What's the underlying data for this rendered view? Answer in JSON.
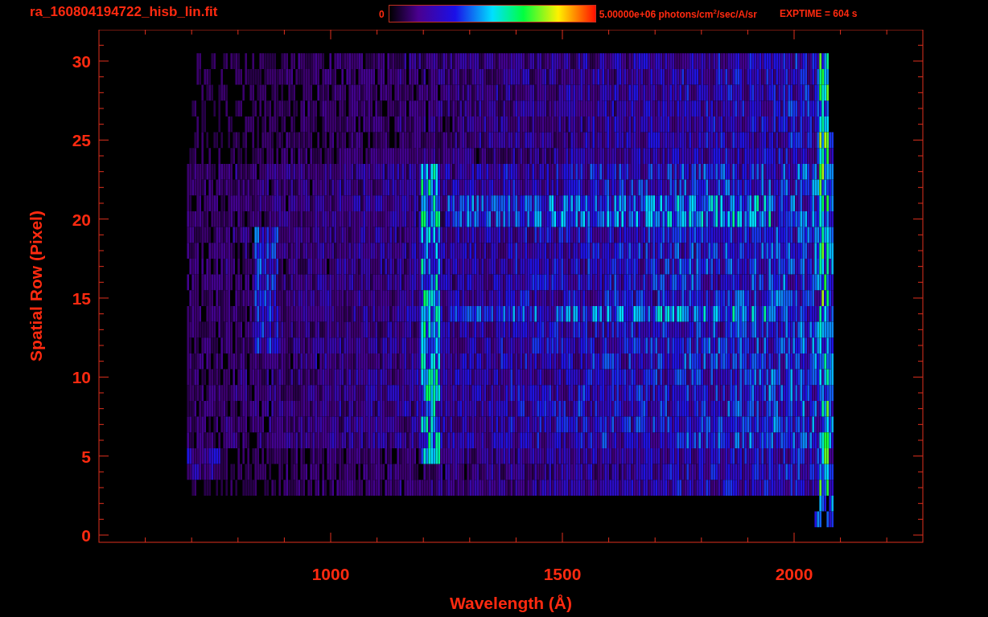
{
  "title": "ra_160804194722_hisb_lin.fit",
  "colorbar": {
    "min_label": "0",
    "max_label": "5.00000e+06 photons/cm$^{2}$/sec/A/sr"
  },
  "exptime": "EXPTIME = 604 s",
  "plot": {
    "xlabel": "Wavelength (Å)",
    "ylabel": "Spatial Row (Pixel)",
    "xticks": [
      "1000",
      "1500",
      "2000"
    ],
    "yticks": [
      "30",
      "25",
      "20",
      "15",
      "10",
      "5",
      "0"
    ]
  }
}
